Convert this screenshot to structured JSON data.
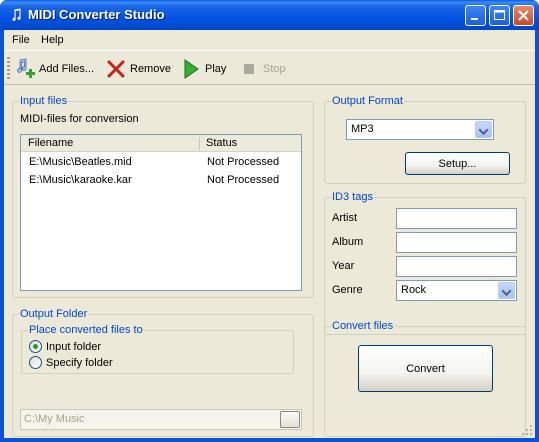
{
  "window": {
    "title": "MIDI Converter Studio"
  },
  "menu": {
    "file": "File",
    "help": "Help"
  },
  "toolbar": {
    "add": "Add Files...",
    "remove": "Remove",
    "play": "Play",
    "stop": "Stop"
  },
  "input": {
    "group_title": "Input files",
    "subtitle": "MIDI-files for conversion",
    "columns": {
      "filename": "Filename",
      "status": "Status"
    },
    "rows": [
      {
        "file": "E:\\Music\\Beatles.mid",
        "status": "Not Processed"
      },
      {
        "file": "E:\\Music\\karaoke.kar",
        "status": "Not Processed"
      }
    ]
  },
  "output_format": {
    "group_title": "Output Format",
    "selected": "MP3",
    "setup": "Setup..."
  },
  "id3": {
    "group_title": "ID3 tags",
    "artist": "Artist",
    "album": "Album",
    "year": "Year",
    "genre": "Genre",
    "artist_value": "",
    "album_value": "",
    "year_value": "",
    "genre_value": "Rock"
  },
  "output_folder": {
    "group_title": "Output Folder",
    "sub_title": "Place converted files to",
    "opt_input": "Input folder",
    "opt_specify": "Specify folder",
    "path": "C:\\My Music"
  },
  "convert": {
    "group_title": "Convert files",
    "button": "Convert"
  }
}
